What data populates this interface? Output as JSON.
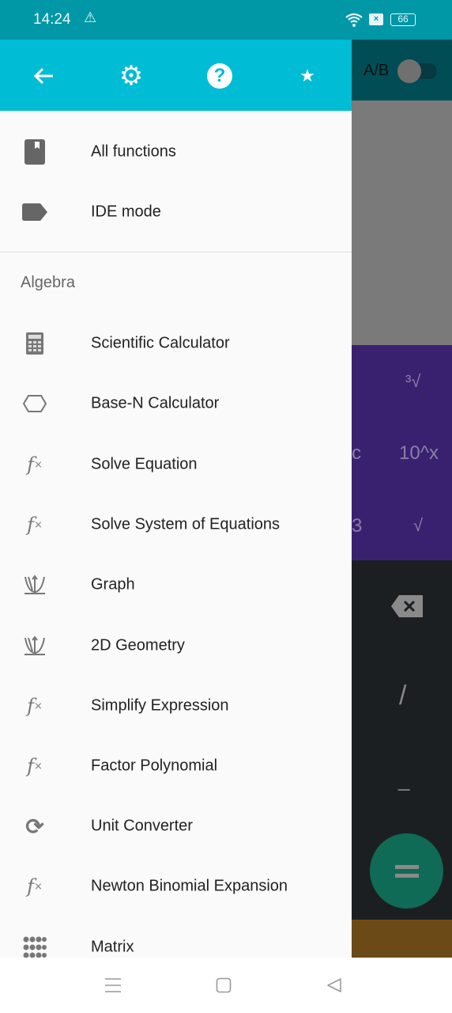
{
  "status_bar": {
    "time": "14:24",
    "battery": "66",
    "icons": [
      "warning-icon",
      "wifi-icon",
      "sim-off-icon",
      "battery-icon"
    ]
  },
  "drawer": {
    "toolbar": {
      "icons": [
        "back-arrow-icon",
        "gear-icon",
        "help-icon",
        "star-icon"
      ]
    },
    "top_items": [
      {
        "label": "All functions",
        "icon": "book-icon"
      },
      {
        "label": "IDE mode",
        "icon": "label-tag-icon"
      }
    ],
    "section": "Algebra",
    "items": [
      {
        "label": "Scientific Calculator",
        "icon": "calculator-icon"
      },
      {
        "label": "Base-N Calculator",
        "icon": "hexagon-icon"
      },
      {
        "label": "Solve Equation",
        "icon": "fx-icon"
      },
      {
        "label": "Solve System of Equations",
        "icon": "fx-icon"
      },
      {
        "label": "Graph",
        "icon": "graph-icon"
      },
      {
        "label": "2D Geometry",
        "icon": "graph-icon"
      },
      {
        "label": "Simplify Expression",
        "icon": "fx-icon"
      },
      {
        "label": "Factor Polynomial",
        "icon": "fx-icon"
      },
      {
        "label": "Unit Converter",
        "icon": "sync-icon"
      },
      {
        "label": "Newton Binomial Expansion",
        "icon": "fx-icon"
      },
      {
        "label": "Matrix",
        "icon": "grid-dots-icon"
      }
    ]
  },
  "background": {
    "toggle_label": "A/B",
    "keys": {
      "cbrt": "³√",
      "c": "c",
      "pow10": "10^x",
      "three": "3",
      "sqrt": "√",
      "divide": "/",
      "minus": "_"
    }
  },
  "colors": {
    "status": "#0097a7",
    "toolbar": "#00bcd4",
    "fab": "#0f6b55"
  }
}
